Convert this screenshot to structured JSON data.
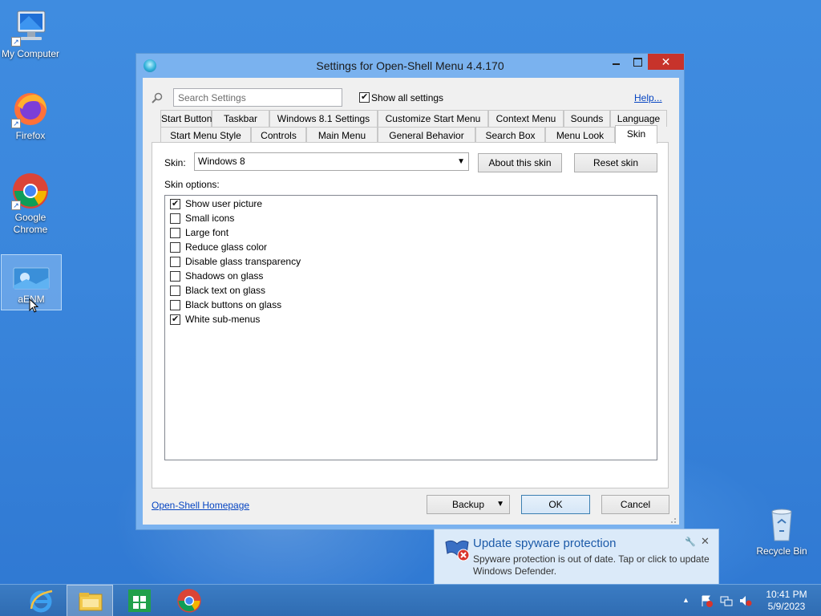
{
  "desktop": {
    "icons": [
      {
        "label": "My Computer"
      },
      {
        "label": "Firefox"
      },
      {
        "label": "Google\nChrome"
      },
      {
        "label": "aENM"
      },
      {
        "label": "Recycle Bin"
      }
    ]
  },
  "dialog": {
    "title": "Settings for Open-Shell Menu 4.4.170",
    "close_glyph": "✕",
    "search_placeholder": "Search Settings",
    "show_all_label": "Show all settings",
    "show_all_checked": true,
    "help_link": "Help...",
    "tabs_row1": [
      "Start Button",
      "Taskbar",
      "Windows 8.1 Settings",
      "Customize Start Menu",
      "Context Menu",
      "Sounds",
      "Language"
    ],
    "tabs_row2": [
      "Start Menu Style",
      "Controls",
      "Main Menu",
      "General Behavior",
      "Search Box",
      "Menu Look",
      "Skin"
    ],
    "active_tab": "Skin",
    "skin_label": "Skin:",
    "skin_value": "Windows 8",
    "about_skin_button": "About this skin",
    "reset_skin_button": "Reset skin",
    "skin_options_label": "Skin options:",
    "options": [
      {
        "label": "Show user picture",
        "checked": true
      },
      {
        "label": "Small icons",
        "checked": false
      },
      {
        "label": "Large font",
        "checked": false
      },
      {
        "label": "Reduce glass color",
        "checked": false
      },
      {
        "label": "Disable glass transparency",
        "checked": false
      },
      {
        "label": "Shadows on glass",
        "checked": false
      },
      {
        "label": "Black text on glass",
        "checked": false
      },
      {
        "label": "Black buttons on glass",
        "checked": false
      },
      {
        "label": "White sub-menus",
        "checked": true
      }
    ],
    "homepage_link": "Open-Shell Homepage",
    "backup_button": "Backup",
    "ok_button": "OK",
    "cancel_button": "Cancel"
  },
  "notification": {
    "title": "Update spyware protection",
    "body": "Spyware protection is out of date. Tap or click to update Windows Defender."
  },
  "taskbar": {
    "clock_time": "10:41 PM",
    "clock_date": "5/9/2023"
  },
  "colors": {
    "desktop": "#3a86dc",
    "close_button": "#c7332b",
    "link": "#0645c2"
  }
}
